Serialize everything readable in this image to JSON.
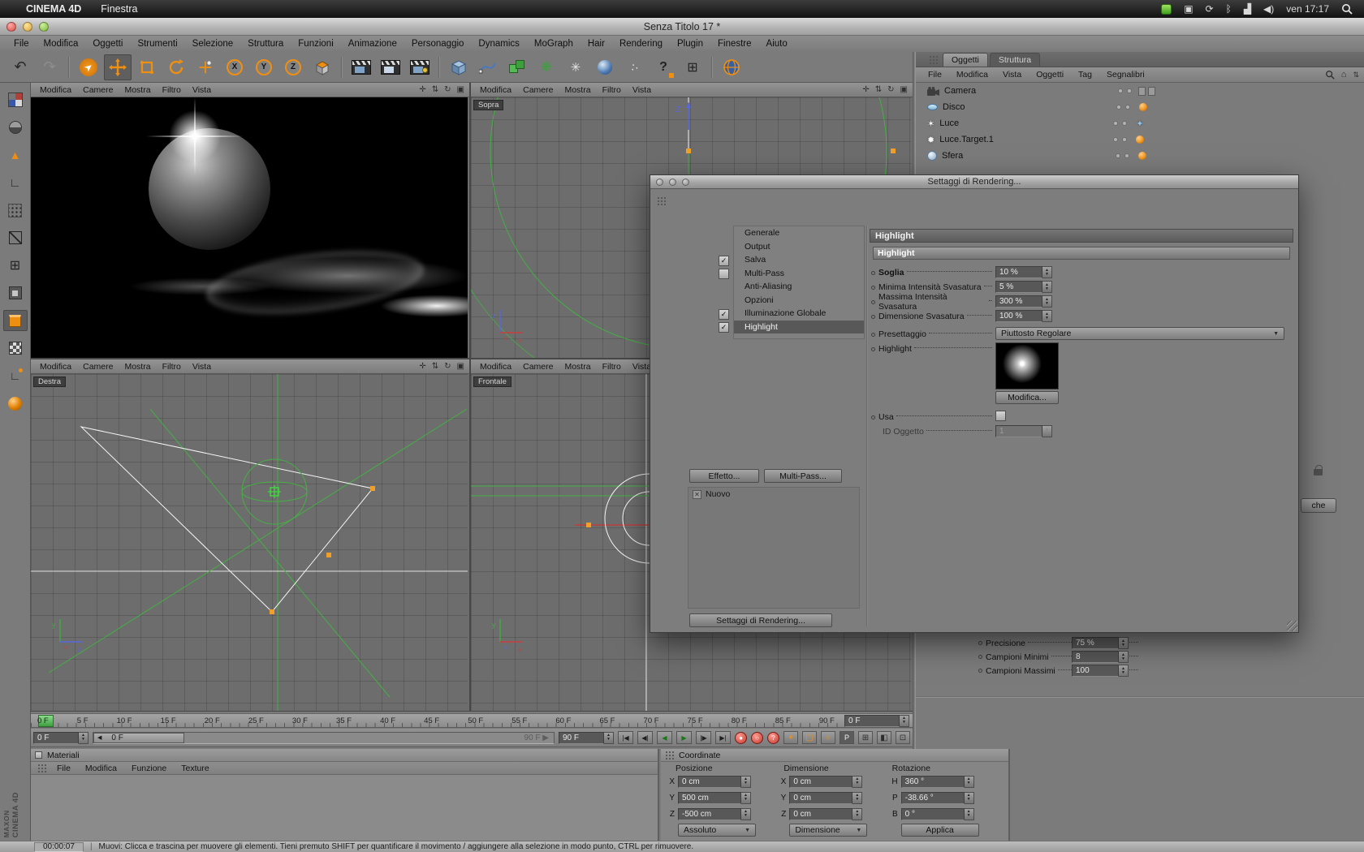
{
  "macos_menubar": {
    "app_name": "CINEMA 4D",
    "menu_items": [
      "Finestra"
    ],
    "clock": "ven 17:17",
    "status_icons": [
      "growl-badge",
      "display-icon",
      "sync-icon",
      "bluetooth-icon",
      "wifi-icon",
      "volume-icon",
      "spotlight-icon"
    ]
  },
  "window_title": "Senza Titolo 17 *",
  "app_menu": [
    "File",
    "Modifica",
    "Oggetti",
    "Strumenti",
    "Selezione",
    "Struttura",
    "Funzioni",
    "Animazione",
    "Personaggio",
    "Dynamics",
    "MoGraph",
    "Hair",
    "Rendering",
    "Plugin",
    "Finestre",
    "Aiuto"
  ],
  "toolbar_icons": [
    "undo",
    "redo",
    "live-selection",
    "move",
    "scale",
    "rotate",
    "last-tool",
    "lock-x",
    "lock-y",
    "lock-z",
    "coordinate-system",
    "render-view",
    "render-active-view",
    "render-settings",
    "primitive-cube",
    "spline",
    "instance",
    "array",
    "particles",
    "sky",
    "emitter",
    "help",
    "attribute-table",
    "browser-globe"
  ],
  "axis_labels": {
    "X": "X",
    "Y": "Y",
    "Z": "Z",
    "x": "x",
    "y": "y",
    "z": "z"
  },
  "viewport_menu": [
    "Modifica",
    "Camere",
    "Mostra",
    "Filtro",
    "Vista"
  ],
  "viewports": {
    "top_right_label": "Sopra",
    "bottom_left_label": "Destra",
    "bottom_right_label": "Frontale"
  },
  "object_manager": {
    "tabs": [
      "Oggetti",
      "Struttura"
    ],
    "menu": [
      "File",
      "Modifica",
      "Vista",
      "Oggetti",
      "Tag",
      "Segnalibri"
    ],
    "objects": [
      {
        "name": "Camera",
        "icon": "camera"
      },
      {
        "name": "Disco",
        "icon": "disc"
      },
      {
        "name": "Luce",
        "icon": "light"
      },
      {
        "name": "Luce.Target.1",
        "icon": "light-target"
      },
      {
        "name": "Sfera",
        "icon": "sphere"
      }
    ]
  },
  "render_dialog": {
    "title": "Settaggi di Rendering...",
    "nav": [
      {
        "label": "Generale"
      },
      {
        "label": "Output"
      },
      {
        "label": "Salva",
        "checked": true
      },
      {
        "label": "Multi-Pass",
        "checked": false
      },
      {
        "label": "Anti-Aliasing"
      },
      {
        "label": "Opzioni"
      },
      {
        "label": "Illuminazione Globale",
        "checked": true
      },
      {
        "label": "Highlight",
        "checked": true,
        "selected": true
      }
    ],
    "panel_title": "Highlight",
    "group_header": "Highlight",
    "params": [
      {
        "label": "Soglia",
        "value": "10 %"
      },
      {
        "label": "Minima Intensità Svasatura",
        "value": "5 %"
      },
      {
        "label": "Massima Intensità Svasatura",
        "value": "300 %"
      },
      {
        "label": "Dimensione Svasatura",
        "value": "100 %"
      }
    ],
    "preset_label": "Presettaggio",
    "preset_value": "Piuttosto Regolare",
    "highlight_label": "Highlight",
    "modify_button": "Modifica...",
    "use_label": "Usa",
    "object_id_label": "ID Oggetto",
    "object_id_value": "1",
    "effect_button": "Effetto...",
    "multipass_button": "Multi-Pass...",
    "new_item": "Nuovo",
    "render_settings_button": "Settaggi di Rendering..."
  },
  "attribute_manager_fragment": {
    "rows": [
      {
        "label": "Precisione",
        "value": "75 %"
      },
      {
        "label": "Campioni Minimi",
        "value": "8"
      },
      {
        "label": "Campioni Massimi",
        "value": "100"
      }
    ],
    "partial_button": "che"
  },
  "timeline": {
    "ticks": [
      "0 F",
      "5 F",
      "10 F",
      "15 F",
      "20 F",
      "25 F",
      "30 F",
      "35 F",
      "40 F",
      "45 F",
      "50 F",
      "55 F",
      "60 F",
      "65 F",
      "70 F",
      "75 F",
      "80 F",
      "85 F",
      "90 F"
    ],
    "ruler_box": "0 F",
    "start_spinner": "0 F",
    "slider_handle": "0 F",
    "slider_end_label": "90 F ▶",
    "end_spinner": "90 F"
  },
  "materials_panel": {
    "title": "Materiali",
    "menu": [
      "File",
      "Modifica",
      "Funzione",
      "Texture"
    ]
  },
  "coordinates_panel": {
    "title": "Coordinate",
    "columns": [
      "Posizione",
      "Dimensione",
      "Rotazione"
    ],
    "position": {
      "x": [
        "X",
        "0 cm"
      ],
      "y": [
        "Y",
        "500 cm"
      ],
      "z": [
        "Z",
        "-500 cm"
      ]
    },
    "dimension": {
      "x": [
        "X",
        "0 cm"
      ],
      "y": [
        "Y",
        "0 cm"
      ],
      "z": [
        "Z",
        "0 cm"
      ]
    },
    "rotation": {
      "h": [
        "H",
        "360 °"
      ],
      "p": [
        "P",
        "-38.66 °"
      ],
      "b": [
        "B",
        "0 °"
      ]
    },
    "mode1": "Assoluto",
    "mode2": "Dimensione",
    "apply": "Applica"
  },
  "status_bar": {
    "time": "00:00:07",
    "message": "Muovi: Clicca e trascina per muovere gli elementi. Tieni premuto SHIFT per quantificare il movimento / aggiungere alla selezione in modo punto, CTRL per rimuovere."
  },
  "branding": {
    "line1": "MAXON",
    "line2": "CINEMA 4D"
  },
  "colors": {
    "accent_orange": "#ef8f12",
    "wire_green": "#44b044",
    "wire_white": "#f5f5f5",
    "axis_blue": "#5668e0",
    "axis_red": "#c84040"
  }
}
